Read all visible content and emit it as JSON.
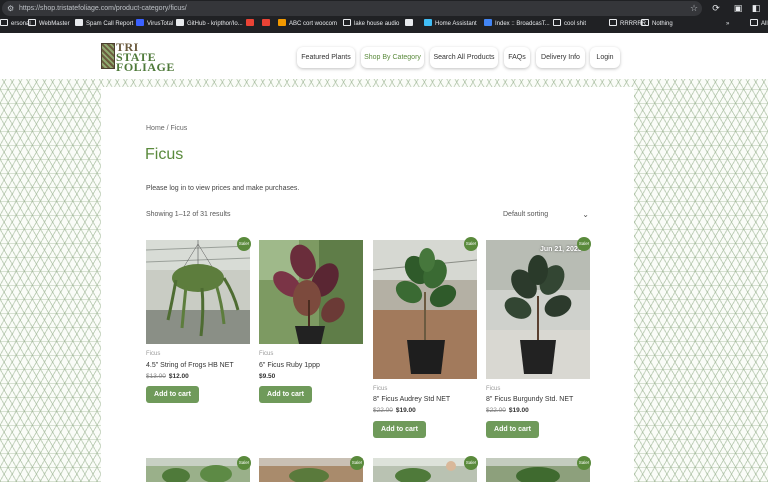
{
  "browser": {
    "url": "https://shop.tristatefoliage.com/product-category/ficus/",
    "bookmarks": [
      {
        "label": "ersonal",
        "icon": "folder-icon"
      },
      {
        "label": "WebMaster",
        "icon": "folder-icon"
      },
      {
        "label": "Spam Call Report",
        "icon": "page-icon"
      },
      {
        "label": "VirusTotal",
        "icon": "virustotal-icon"
      },
      {
        "label": "GitHub - kripthor/Io...",
        "icon": "github-icon"
      },
      {
        "label": "",
        "icon": "gmail-icon"
      },
      {
        "label": "",
        "icon": "gmail-icon"
      },
      {
        "label": "ABC cort woocom",
        "icon": "ab-icon"
      },
      {
        "label": "lake house audio",
        "icon": "folder-icon"
      },
      {
        "label": "",
        "icon": "apple-icon"
      },
      {
        "label": "Home Assistant",
        "icon": "home-assistant-icon"
      },
      {
        "label": "Index :: BroadcasT...",
        "icon": "power-icon"
      },
      {
        "label": "cool shit",
        "icon": "folder-icon"
      },
      {
        "label": "RRRRRR",
        "icon": "folder-icon"
      },
      {
        "label": "Nothing",
        "icon": "folder-icon"
      },
      {
        "label": "»",
        "icon": ""
      },
      {
        "label": "All",
        "icon": "folder-icon"
      }
    ]
  },
  "header": {
    "logo": [
      "TRI",
      "STATE",
      "FOLIAGE"
    ],
    "nav": [
      {
        "label": "Featured Plants",
        "active": false
      },
      {
        "label": "Shop By Category",
        "active": true
      },
      {
        "label": "Search All Products",
        "active": false
      },
      {
        "label": "FAQs",
        "active": false
      },
      {
        "label": "Delivery Info",
        "active": false
      },
      {
        "label": "Login",
        "active": false
      }
    ]
  },
  "main": {
    "breadcrumb": "Home / Ficus",
    "title": "Ficus",
    "login_note": "Please log in to view prices and make purchases.",
    "results": "Showing 1–12 of 31 results",
    "sort_label": "Default sorting"
  },
  "products": [
    {
      "category": "Ficus",
      "name": "4.5\" String of Frogs HB NET",
      "old_price": "$13.00",
      "new_price": "$12.00",
      "sale": "Sale!",
      "cart": "Add to cart"
    },
    {
      "category": "Ficus",
      "name": "6\" Ficus Ruby 1ppp",
      "old_price": "",
      "new_price": "$9.50",
      "sale": "",
      "cart": "Add to cart"
    },
    {
      "category": "Ficus",
      "name": "8\" Ficus Audrey Std NET",
      "old_price": "$22.00",
      "new_price": "$19.00",
      "sale": "Sale!",
      "cart": "Add to cart"
    },
    {
      "category": "Ficus",
      "name": "8\" Ficus Burgundy Std. NET",
      "old_price": "$22.00",
      "new_price": "$19.00",
      "sale": "Sale!",
      "cart": "Add to cart",
      "image_caption": "Jun 21, 2023"
    }
  ],
  "colors": {
    "accent": "#5a8a3c",
    "button": "#6f9a5a",
    "chrome": "#202124"
  }
}
